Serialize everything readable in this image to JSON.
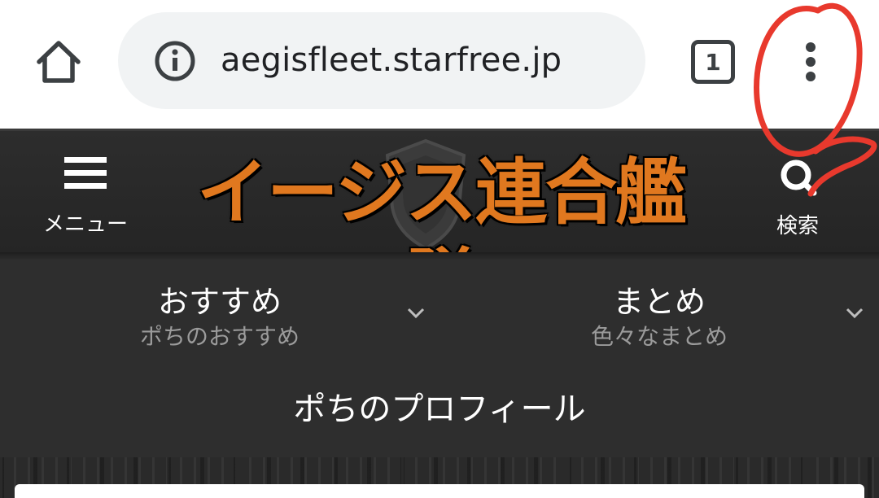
{
  "browser": {
    "url": "aegisfleet.starfree.jp",
    "tab_count": "1",
    "icons": {
      "home": "home-icon",
      "site_info": "info-icon",
      "tabs": "tab-switcher-icon",
      "menu": "more-vert-icon"
    }
  },
  "header": {
    "menu_label": "メニュー",
    "site_title": "イージス連合艦隊",
    "search_label": "検索",
    "colors": {
      "title": "#e0781f",
      "background": "#262626"
    }
  },
  "nav": {
    "items": [
      {
        "title": "おすすめ",
        "subtitle": "ポちのおすすめ"
      },
      {
        "title": "まとめ",
        "subtitle": "色々なまとめ"
      }
    ],
    "profile": "ポちのプロフィール"
  },
  "annotation": {
    "color": "#e8392d",
    "target": "more-vert-icon"
  }
}
